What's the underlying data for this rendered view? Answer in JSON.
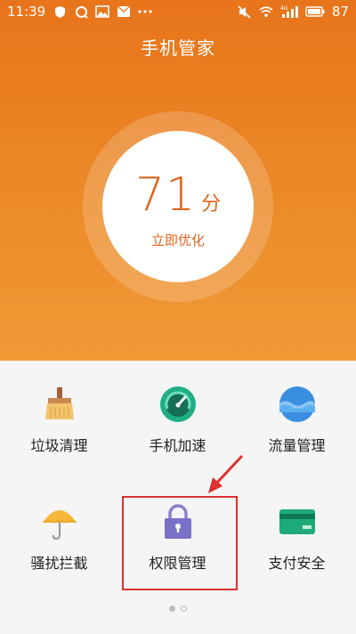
{
  "status_bar": {
    "time": "11:39",
    "network_label": "4G",
    "battery": "87"
  },
  "header": {
    "title": "手机管家"
  },
  "score": {
    "value": "71",
    "unit": "分",
    "action": "立即优化"
  },
  "tools": [
    {
      "label": "垃圾清理",
      "icon": "broom-icon"
    },
    {
      "label": "手机加速",
      "icon": "speedometer-icon"
    },
    {
      "label": "流量管理",
      "icon": "data-wave-icon"
    },
    {
      "label": "骚扰拦截",
      "icon": "umbrella-icon"
    },
    {
      "label": "权限管理",
      "icon": "lock-icon"
    },
    {
      "label": "支付安全",
      "icon": "card-icon"
    }
  ],
  "pager": {
    "pages": 2,
    "active": 1
  },
  "colors": {
    "accent": "#e8741b",
    "score_text": "#e0641a",
    "highlight": "#e03030"
  }
}
